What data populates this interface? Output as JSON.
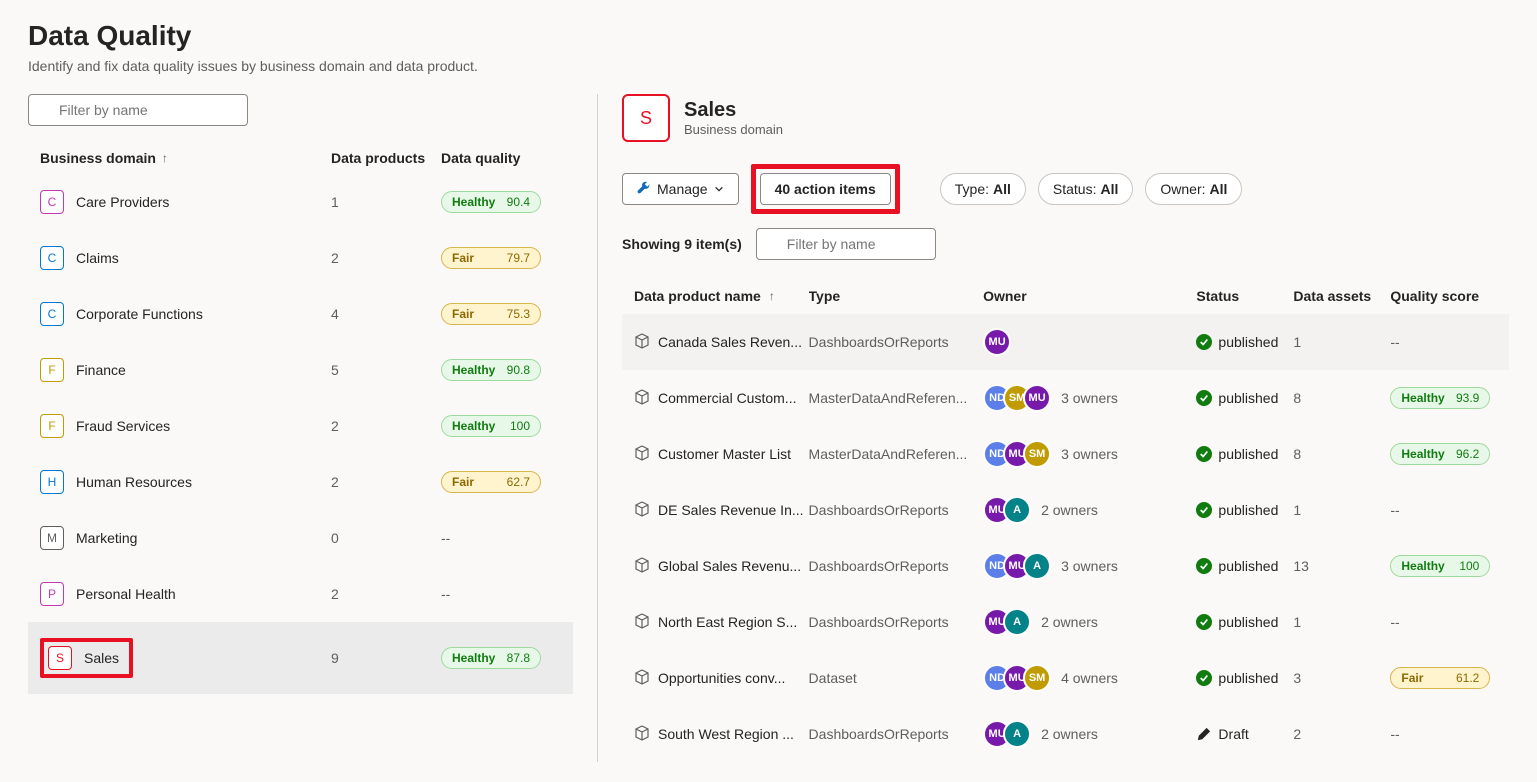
{
  "page": {
    "title": "Data Quality",
    "subtitle": "Identify and fix data quality issues by business domain and data product.",
    "filter_placeholder": "Filter by name"
  },
  "left_table": {
    "headers": {
      "domain": "Business domain",
      "data_products": "Data products",
      "data_quality": "Data quality"
    },
    "rows": [
      {
        "letter": "C",
        "name": "Care Providers",
        "color": "#c239b3",
        "dp": "1",
        "dq_label": "Healthy",
        "dq_value": "90.4",
        "dq_class": "healthy"
      },
      {
        "letter": "C",
        "name": "Claims",
        "color": "#0078d4",
        "dp": "2",
        "dq_label": "Fair",
        "dq_value": "79.7",
        "dq_class": "fair"
      },
      {
        "letter": "C",
        "name": "Corporate Functions",
        "color": "#0078d4",
        "dp": "4",
        "dq_label": "Fair",
        "dq_value": "75.3",
        "dq_class": "fair"
      },
      {
        "letter": "F",
        "name": "Finance",
        "color": "#c19c00",
        "dp": "5",
        "dq_label": "Healthy",
        "dq_value": "90.8",
        "dq_class": "healthy"
      },
      {
        "letter": "F",
        "name": "Fraud Services",
        "color": "#c19c00",
        "dp": "2",
        "dq_label": "Healthy",
        "dq_value": "100",
        "dq_class": "healthy"
      },
      {
        "letter": "H",
        "name": "Human Resources",
        "color": "#0078d4",
        "dp": "2",
        "dq_label": "Fair",
        "dq_value": "62.7",
        "dq_class": "fair"
      },
      {
        "letter": "M",
        "name": "Marketing",
        "color": "#605e5c",
        "dp": "0",
        "dq_label": "--",
        "dq_value": "",
        "dq_class": "none"
      },
      {
        "letter": "P",
        "name": "Personal Health",
        "color": "#c239b3",
        "dp": "2",
        "dq_label": "--",
        "dq_value": "",
        "dq_class": "none"
      },
      {
        "letter": "S",
        "name": "Sales",
        "color": "#e81123",
        "dp": "9",
        "dq_label": "Healthy",
        "dq_value": "87.8",
        "dq_class": "healthy",
        "selected": true,
        "highlighted": true
      }
    ]
  },
  "detail": {
    "letter": "S",
    "title": "Sales",
    "subtitle": "Business domain",
    "manage_label": "Manage",
    "action_items_label": "40 action items",
    "filters": {
      "type": {
        "label": "Type:",
        "value": "All"
      },
      "status": {
        "label": "Status:",
        "value": "All"
      },
      "owner": {
        "label": "Owner:",
        "value": "All"
      }
    },
    "showing_text": "Showing 9 item(s)",
    "filter_placeholder": "Filter by name"
  },
  "products_table": {
    "headers": {
      "name": "Data product name",
      "type": "Type",
      "owner": "Owner",
      "status": "Status",
      "assets": "Data assets",
      "score": "Quality score"
    },
    "rows": [
      {
        "name": "Canada Sales Reven...",
        "type": "DashboardsOrReports",
        "owners": [
          {
            "initials": "MU",
            "color": "#7719aa"
          }
        ],
        "owner_count": "",
        "status": "published",
        "status_icon": "check",
        "assets": "1",
        "score_label": "--",
        "score_value": "",
        "score_class": "none",
        "highlight": true
      },
      {
        "name": "Commercial Custom...",
        "type": "MasterDataAndReferen...",
        "owners": [
          {
            "initials": "ND",
            "color": "#5b7ee8"
          },
          {
            "initials": "SM",
            "color": "#c19c00"
          },
          {
            "initials": "MU",
            "color": "#7719aa"
          }
        ],
        "owner_count": "3 owners",
        "status": "published",
        "status_icon": "check",
        "assets": "8",
        "score_label": "Healthy",
        "score_value": "93.9",
        "score_class": "healthy"
      },
      {
        "name": "Customer Master List",
        "type": "MasterDataAndReferen...",
        "owners": [
          {
            "initials": "ND",
            "color": "#5b7ee8"
          },
          {
            "initials": "MU",
            "color": "#7719aa"
          },
          {
            "initials": "SM",
            "color": "#c19c00"
          }
        ],
        "owner_count": "3 owners",
        "status": "published",
        "status_icon": "check",
        "assets": "8",
        "score_label": "Healthy",
        "score_value": "96.2",
        "score_class": "healthy"
      },
      {
        "name": "DE Sales Revenue In...",
        "type": "DashboardsOrReports",
        "owners": [
          {
            "initials": "MU",
            "color": "#7719aa"
          },
          {
            "initials": "A",
            "color": "#038387"
          }
        ],
        "owner_count": "2 owners",
        "status": "published",
        "status_icon": "check",
        "assets": "1",
        "score_label": "--",
        "score_value": "",
        "score_class": "none"
      },
      {
        "name": "Global Sales Revenu...",
        "type": "DashboardsOrReports",
        "owners": [
          {
            "initials": "ND",
            "color": "#5b7ee8"
          },
          {
            "initials": "MU",
            "color": "#7719aa"
          },
          {
            "initials": "A",
            "color": "#038387"
          }
        ],
        "owner_count": "3 owners",
        "status": "published",
        "status_icon": "check",
        "assets": "13",
        "score_label": "Healthy",
        "score_value": "100",
        "score_class": "healthy"
      },
      {
        "name": "North East Region S...",
        "type": "DashboardsOrReports",
        "owners": [
          {
            "initials": "MU",
            "color": "#7719aa"
          },
          {
            "initials": "A",
            "color": "#038387"
          }
        ],
        "owner_count": "2 owners",
        "status": "published",
        "status_icon": "check",
        "assets": "1",
        "score_label": "--",
        "score_value": "",
        "score_class": "none"
      },
      {
        "name": "Opportunities conv...",
        "type": "Dataset",
        "owners": [
          {
            "initials": "ND",
            "color": "#5b7ee8"
          },
          {
            "initials": "MU",
            "color": "#7719aa"
          },
          {
            "initials": "SM",
            "color": "#c19c00"
          }
        ],
        "owner_count": "4 owners",
        "status": "published",
        "status_icon": "check",
        "assets": "3",
        "score_label": "Fair",
        "score_value": "61.2",
        "score_class": "fair"
      },
      {
        "name": "South West Region ...",
        "type": "DashboardsOrReports",
        "owners": [
          {
            "initials": "MU",
            "color": "#7719aa"
          },
          {
            "initials": "A",
            "color": "#038387"
          }
        ],
        "owner_count": "2 owners",
        "status": "Draft",
        "status_icon": "draft",
        "assets": "2",
        "score_label": "--",
        "score_value": "",
        "score_class": "none"
      }
    ]
  }
}
